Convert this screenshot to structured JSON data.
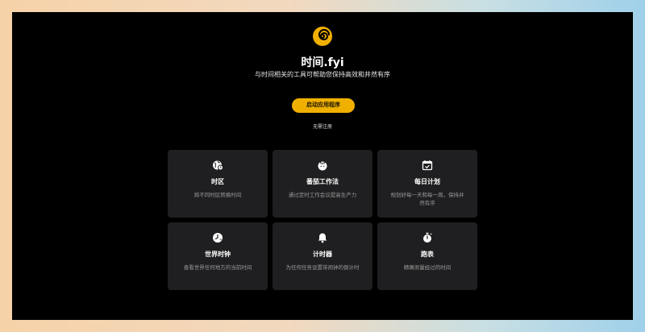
{
  "app": {
    "title": "时间.fyi",
    "subtitle": "与时间相关的工具可帮助您保持高效和井然有序",
    "launch_button": "启动应用程序",
    "signup_link": "无需注册",
    "accent_color": "#f0b000"
  },
  "cards": [
    {
      "icon": "timezone-globe-icon",
      "title": "时区",
      "description": "跨不同时区转换时间"
    },
    {
      "icon": "tomato-icon",
      "title": "番茄工作法",
      "description": "通过定时工作会议提高生产力"
    },
    {
      "icon": "calendar-icon",
      "title": "每日计划",
      "description": "规划好每一天和每一周，保持井然有序"
    },
    {
      "icon": "world-clock-icon",
      "title": "世界时钟",
      "description": "查看世界任何地方的当前时间"
    },
    {
      "icon": "bell-icon",
      "title": "计时器",
      "description": "为任何任务设置带闹钟的倒计时"
    },
    {
      "icon": "stopwatch-icon",
      "title": "跑表",
      "description": "精确测量经过的时间"
    }
  ]
}
